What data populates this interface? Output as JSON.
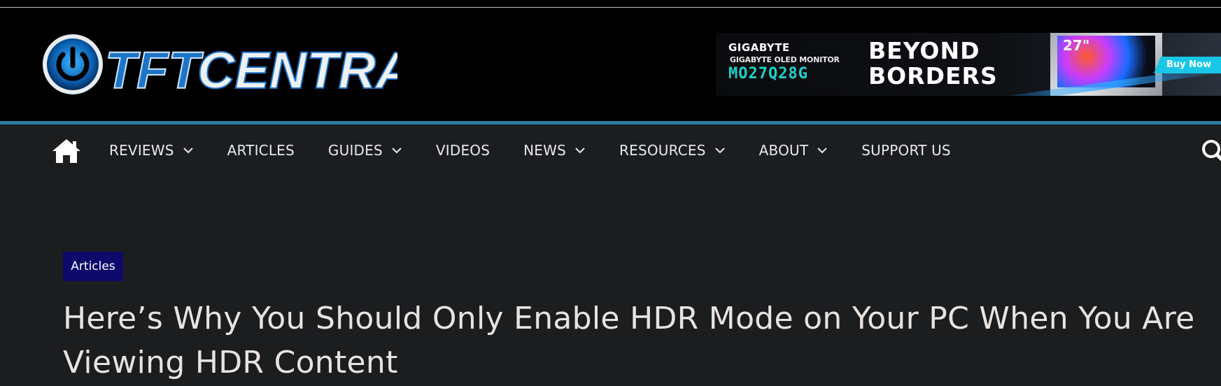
{
  "logo": {
    "text_main": "TFT",
    "text_secondary": "CENTRAL"
  },
  "ad": {
    "brand": "GIGABYTE",
    "subtitle": "GIGABYTE OLED MONITOR",
    "model": "MO27Q28G",
    "headline_line1": "BEYOND",
    "headline_line2": "BORDERS",
    "monitor_size": "27\"",
    "cta": "Buy Now"
  },
  "nav": {
    "home_icon": "home-icon",
    "items": [
      {
        "label": "REVIEWS",
        "has_dropdown": true
      },
      {
        "label": "ARTICLES",
        "has_dropdown": false
      },
      {
        "label": "GUIDES",
        "has_dropdown": true
      },
      {
        "label": "VIDEOS",
        "has_dropdown": false
      },
      {
        "label": "NEWS",
        "has_dropdown": true
      },
      {
        "label": "RESOURCES",
        "has_dropdown": true
      },
      {
        "label": "ABOUT",
        "has_dropdown": true
      },
      {
        "label": "SUPPORT US",
        "has_dropdown": false
      }
    ],
    "search_icon": "search-icon"
  },
  "article": {
    "category": "Articles",
    "title": "Here’s Why You Should Only Enable HDR Mode on Your PC When You Are Viewing HDR Content"
  },
  "colors": {
    "header_bg": "#000000",
    "page_bg": "#1b1d1f",
    "nav_accent": "#2b7aa0",
    "badge_bg": "#0d0a6b",
    "ad_model": "#1fd1c8"
  }
}
